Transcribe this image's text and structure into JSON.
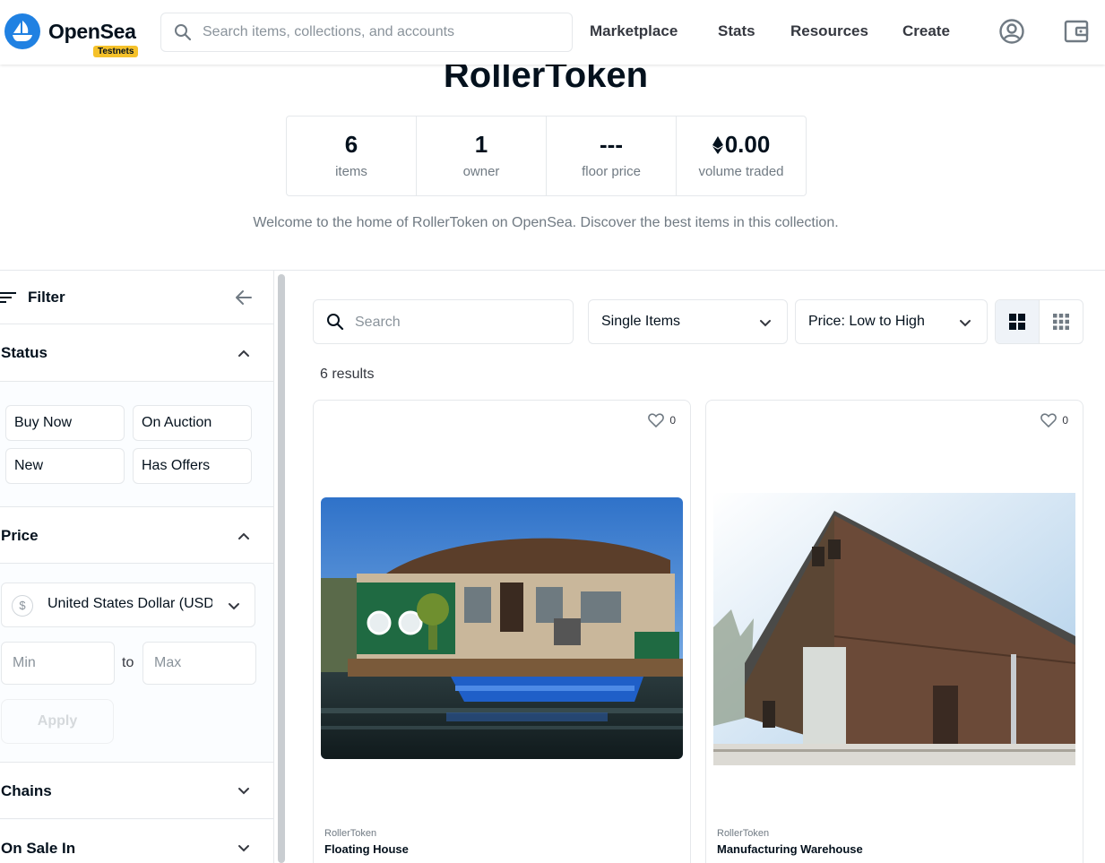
{
  "header": {
    "brand": "OpenSea",
    "badge": "Testnets",
    "search_placeholder": "Search items, collections, and accounts",
    "nav": [
      "Marketplace",
      "Stats",
      "Resources",
      "Create"
    ],
    "icons": [
      "account-icon",
      "wallet-icon"
    ]
  },
  "collection": {
    "title": "RollerToken",
    "stats": [
      {
        "value": "6",
        "label": "items"
      },
      {
        "value": "1",
        "label": "owner"
      },
      {
        "value": "---",
        "label": "floor price"
      },
      {
        "value": "0.00",
        "label": "volume traded",
        "icon": "eth-icon"
      }
    ],
    "description": "Welcome to the home of RollerToken on OpenSea. Discover the best items in this collection."
  },
  "sidebar": {
    "filter_label": "Filter",
    "status": {
      "title": "Status",
      "options": [
        "Buy Now",
        "On Auction",
        "New",
        "Has Offers"
      ]
    },
    "price": {
      "title": "Price",
      "currency": "United States Dollar (USD)",
      "min_placeholder": "Min",
      "to_label": "to",
      "max_placeholder": "Max",
      "apply_label": "Apply"
    },
    "chains_title": "Chains",
    "on_sale_title": "On Sale In"
  },
  "main": {
    "search_placeholder": "Search",
    "item_type": "Single Items",
    "sort": "Price: Low to High",
    "results": "6 results",
    "cards": [
      {
        "collection": "RollerToken",
        "name": "Floating House",
        "favorites": "0"
      },
      {
        "collection": "RollerToken",
        "name": "Manufacturing Warehouse",
        "favorites": "0"
      }
    ]
  },
  "colors": {
    "brand_blue": "#2081e2",
    "badge_yellow": "#f5c12a",
    "text_dark": "#04111d",
    "text_gray": "#707a83",
    "border": "#e5e8eb"
  }
}
